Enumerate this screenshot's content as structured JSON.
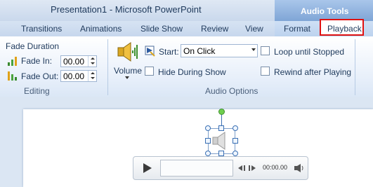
{
  "window": {
    "title": "Presentation1 - Microsoft PowerPoint",
    "context_header": "Audio Tools"
  },
  "tabs": [
    "Transitions",
    "Animations",
    "Slide Show",
    "Review",
    "View",
    "Format",
    "Playback"
  ],
  "active_tab": "Playback",
  "editing_group": {
    "header": "Fade Duration",
    "fade_in_label": "Fade In:",
    "fade_in_value": "00.00",
    "fade_out_label": "Fade Out:",
    "fade_out_value": "00.00",
    "label": "Editing"
  },
  "audio_options_group": {
    "volume_label": "Volume",
    "start_label": "Start:",
    "start_value": "On Click",
    "hide_during_show": "Hide During Show",
    "loop_until_stopped": "Loop until Stopped",
    "rewind_after_playing": "Rewind after Playing",
    "label": "Audio Options"
  },
  "player": {
    "time": "00:00.00"
  },
  "colors": {
    "highlight_border": "#e01111",
    "handle": "#3a6fb3",
    "rotation_handle": "#6fcf4f"
  }
}
